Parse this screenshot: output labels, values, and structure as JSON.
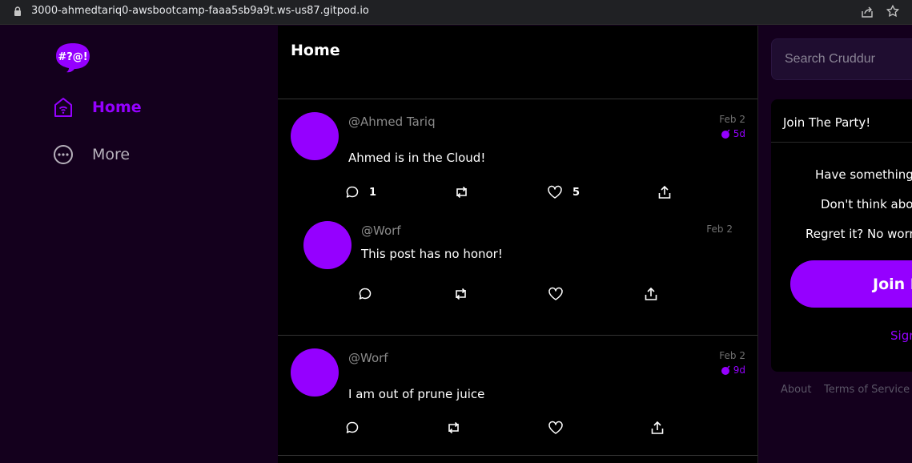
{
  "browser": {
    "url": "3000-ahmedtariq0-awsbootcamp-faaa5sb9a9t.ws-us87.gitpod.io"
  },
  "sidebar": {
    "logo_text": "#?@!",
    "items": [
      {
        "label": "Home",
        "icon": "home-icon",
        "active": true
      },
      {
        "label": "More",
        "icon": "more-icon",
        "active": false
      }
    ]
  },
  "feed": {
    "title": "Home",
    "posts": [
      {
        "handle": "@Ahmed Tariq",
        "message": "Ahmed is in the Cloud!",
        "date": "Feb 2",
        "ttl": "5d",
        "replies": "1",
        "likes": "5"
      },
      {
        "handle": "@Worf",
        "message": "This post has no honor!",
        "date": "Feb 2",
        "is_reply": true
      },
      {
        "handle": "@Worf",
        "message": "I am out of prune juice",
        "date": "Feb 2",
        "ttl": "9d"
      }
    ]
  },
  "right": {
    "search_placeholder": "Search Cruddur",
    "join": {
      "title": "Join The Party!",
      "line1": "Have something y",
      "line2": "Don't think abou",
      "line3": "Regret it? No worri",
      "button": "Join N",
      "signin": "Sign"
    },
    "footer": [
      "About",
      "Terms of Service"
    ]
  },
  "colors": {
    "accent": "#9500ff",
    "background": "#14001d",
    "feed_background": "#000000"
  }
}
